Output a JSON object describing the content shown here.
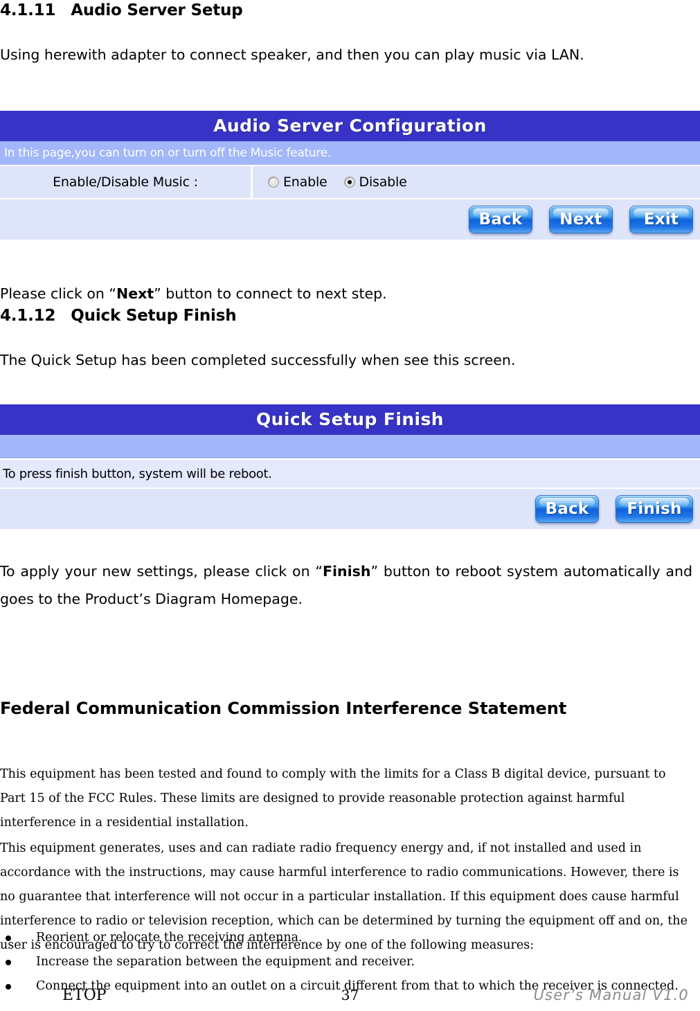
{
  "document": {
    "sections": [
      {
        "number": "4.1.11",
        "title": "Audio Server Setup"
      },
      {
        "number": "4.1.12",
        "title": "Quick Setup Finish"
      }
    ],
    "intro_paragraph": "Using herewith adapter to connect speaker, and then you can play music via LAN.",
    "next_instruction_prefix": "Please click on “",
    "next_instruction_bold": "Next",
    "next_instruction_suffix": "” button to connect to next step.",
    "finish_intro": "The Quick Setup has been completed successfully when see this screen.",
    "finish_instruction_prefix": "To apply your new settings, please click on “",
    "finish_instruction_bold": "Finish",
    "finish_instruction_suffix": "” button to reboot system automatically and goes to the Product’s Diagram Homepage."
  },
  "audio_panel": {
    "title": "Audio Server Configuration",
    "subtitle": "In this page,you can turn on or turn off the Music feature.",
    "field_label": "Enable/Disable Music :",
    "options": [
      {
        "label": "Enable",
        "selected": false
      },
      {
        "label": "Disable",
        "selected": true
      }
    ],
    "buttons": [
      {
        "label": "Back"
      },
      {
        "label": "Next"
      },
      {
        "label": "Exit"
      }
    ]
  },
  "finish_panel": {
    "title": "Quick Setup Finish",
    "subtitle": "",
    "message": "To press finish button, system will be reboot.",
    "buttons": [
      {
        "label": "Back"
      },
      {
        "label": "Finish"
      }
    ]
  },
  "fcc": {
    "heading": "Federal Communication Commission Interference Statement",
    "paragraph_1": "This equipment has been tested and found to comply with the limits for a Class B digital device, pursuant to Part 15 of the FCC Rules. These limits are designed to provide reasonable protection against harmful interference in a residential installation.",
    "paragraph_2": "This equipment generates, uses and can radiate radio frequency energy and, if not installed and used in accordance with the instructions, may cause harmful interference to radio communications. However, there is no guarantee that interference will not occur in a particular installation. If this equipment does cause harmful interference to radio or television reception, which can be determined by turning the equipment off and on, the user is encouraged to try to correct the interference by one of the following measures:",
    "measures": [
      "Reorient or relocate the receiving antenna.",
      "Increase the separation between the equipment and receiver.",
      "Connect the equipment into an outlet on a circuit different from that to which the receiver is connected."
    ]
  },
  "footer": {
    "left": "ETOP",
    "page_number": "37",
    "right": "User’s Manual V1.0"
  },
  "colors": {
    "panel_header": "#3733c6",
    "panel_subtitle": "#a2b6fa",
    "panel_body": "#dee4fa",
    "button_blue": "#1f74e6",
    "footer_right_text": "#8a8a8a"
  }
}
